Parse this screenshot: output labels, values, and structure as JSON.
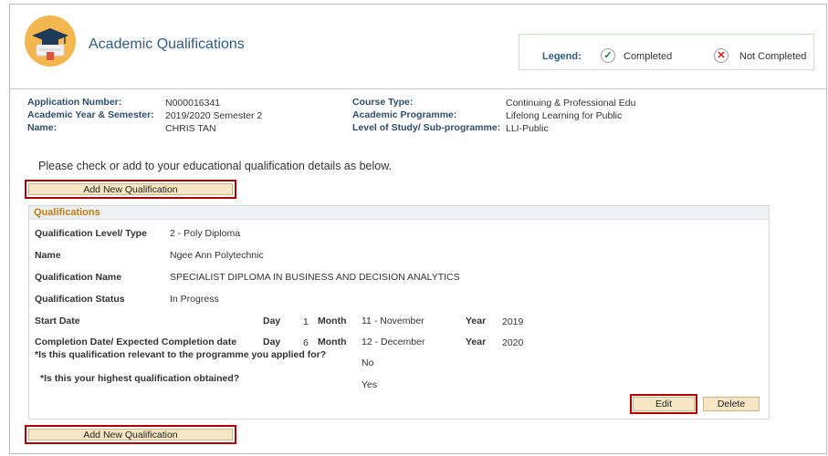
{
  "header": {
    "title": "Academic Qualifications",
    "icon": "graduation-cap-icon"
  },
  "legend": {
    "label": "Legend:",
    "completed_symbol": "✓",
    "completed_label": "Completed",
    "not_completed_symbol": "✕",
    "not_completed_label": "Not Completed"
  },
  "application": {
    "application_number_label": "Application Number:",
    "application_number": "N000016341",
    "academic_year_label": "Academic Year & Semester:",
    "academic_year": "2019/2020 Semester 2",
    "name_label": "Name:",
    "name": "CHRIS TAN",
    "course_type_label": "Course Type:",
    "course_type": "Continuing & Professional Edu",
    "academic_programme_label": "Academic Programme:",
    "academic_programme": "Lifelong Learning for Public",
    "level_of_study_label": "Level of Study/ Sub-programme:",
    "level_of_study": "LLI-Public"
  },
  "instruction": "Please check or add to your educational qualification details as below.",
  "buttons": {
    "add_new": "Add New Qualification",
    "edit": "Edit",
    "delete": "Delete"
  },
  "qualification": {
    "section_title": "Qualifications",
    "level_label": "Qualification Level/ Type",
    "level": "2 - Poly Diploma",
    "name_label": "Name",
    "name": "Ngee Ann Polytechnic",
    "qual_name_label": "Qualification Name",
    "qual_name": "SPECIALIST DIPLOMA IN BUSINESS AND DECISION ANALYTICS",
    "status_label": "Qualification Status",
    "status": "In Progress",
    "start_label": "Start Date",
    "completion_label": "Completion Date/ Expected Completion date",
    "day_label": "Day",
    "month_label": "Month",
    "year_label": "Year",
    "start_day": "1",
    "start_month": "11 - November",
    "start_year": "2019",
    "completion_day": "6",
    "completion_month": "12 - December",
    "completion_year": "2020",
    "relevant_question": "*Is this qualification relevant to the programme you applied for?",
    "relevant_answer": "No",
    "highest_question": "*Is this your highest qualification obtained?",
    "highest_answer": "Yes"
  },
  "colors": {
    "title_blue": "#2d5c8a",
    "section_orange": "#c77a19",
    "button_bg": "#f7e6c4",
    "highlight_red": "#b00000"
  }
}
